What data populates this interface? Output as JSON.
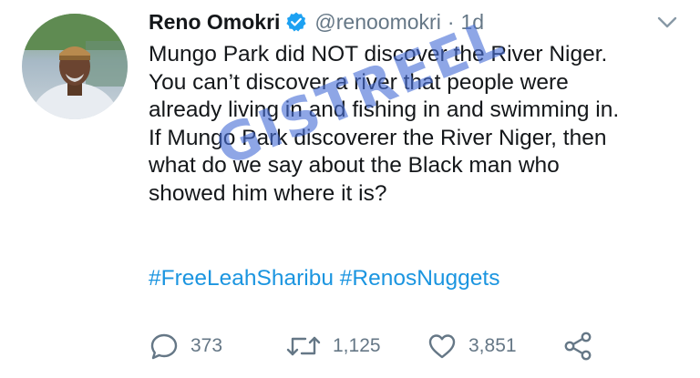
{
  "tweet": {
    "author_name": "Reno Omokri",
    "handle": "@renoomokri",
    "separator": "·",
    "time": "1d",
    "body_lines": [
      "Mungo Park did NOT discover the River Niger.",
      "You can’t discover a river that people were",
      "already living in and fishing in and swimming in.",
      "If Mungo Park discoverer the River Niger, then",
      "what do we say about the Black man who",
      "showed him where it is?"
    ],
    "hashtags": [
      "#FreeLeahSharibu",
      "#RenosNuggets"
    ],
    "hashtag_gap": " "
  },
  "watermark": "GISTREEL",
  "actions": {
    "reply_count": "373",
    "retweet_count": "1,125",
    "like_count": "3,851"
  },
  "colors": {
    "text": "#14171a",
    "secondary": "#657786",
    "link": "#1b95e0",
    "verified": "#1da1f2"
  },
  "icons": {
    "verified": "verified-badge-icon",
    "chevron": "chevron-down-icon",
    "reply": "reply-icon",
    "retweet": "retweet-icon",
    "like": "heart-icon",
    "share": "share-icon"
  }
}
